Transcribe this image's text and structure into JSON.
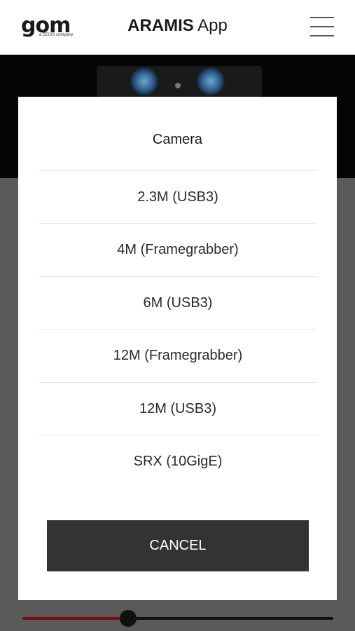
{
  "header": {
    "logo_text": "gom",
    "logo_subtext": "a ZEISS company",
    "title_bold": "ARAMIS",
    "title_rest": " App",
    "menu_icon": "hamburger-menu-icon"
  },
  "dialog": {
    "title": "Camera",
    "options": [
      "2.3M (USB3)",
      "4M (Framegrabber)",
      "6M (USB3)",
      "12M (Framegrabber)",
      "12M (USB3)",
      "SRX (10GigE)"
    ],
    "cancel_label": "CANCEL"
  },
  "slider": {
    "value_fraction": 0.34,
    "fill_color": "#7a0a14"
  },
  "colors": {
    "header_bg": "#ffffff",
    "banner_bg": "#050505",
    "overlay_bg": "#5a5a5a",
    "button_bg": "#333333"
  }
}
